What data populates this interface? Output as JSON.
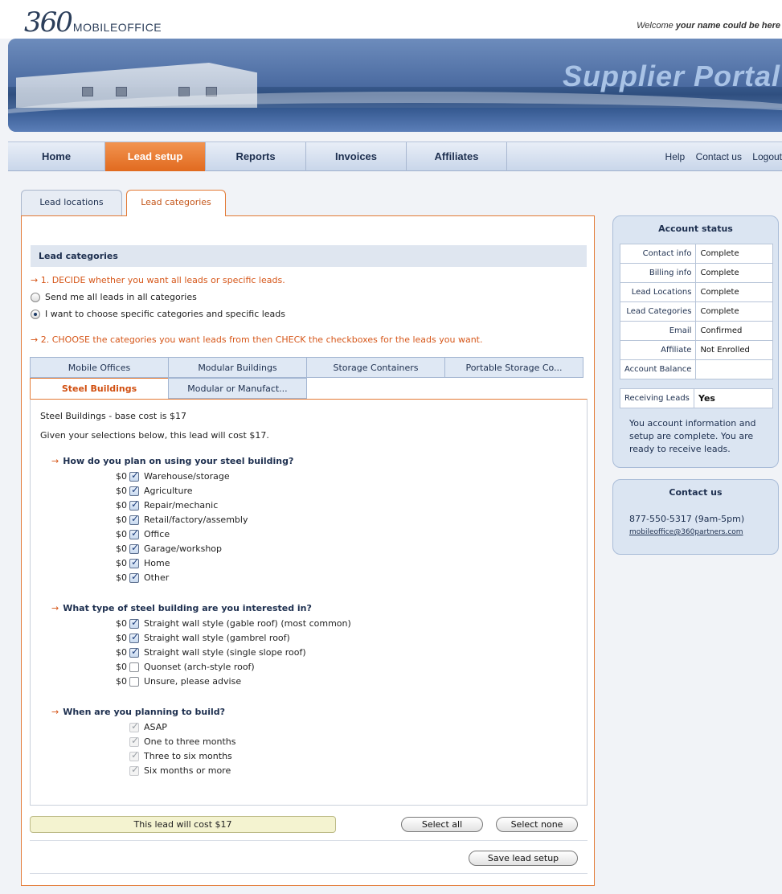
{
  "header": {
    "logo_number": "360",
    "logo_text": "MOBILEOFFICE",
    "welcome_prefix": "Welcome ",
    "welcome_name": "your name could be here",
    "banner_title": "Supplier Portal"
  },
  "nav": {
    "items": [
      {
        "label": "Home"
      },
      {
        "label": "Lead setup"
      },
      {
        "label": "Reports"
      },
      {
        "label": "Invoices"
      },
      {
        "label": "Affiliates"
      }
    ],
    "active": "Lead setup",
    "right": [
      "Help",
      "Contact us",
      "Logout"
    ]
  },
  "page_tabs": [
    {
      "label": "Lead locations"
    },
    {
      "label": "Lead categories"
    }
  ],
  "lead": {
    "section_title": "Lead categories",
    "step1": "→ 1. DECIDE whether you want all leads or specific leads.",
    "radio_all": "Send me all leads in all categories",
    "radio_specific": "I want to choose specific categories and specific leads",
    "step2": "→ 2. CHOOSE the categories you want leads from then CHECK the checkboxes for the leads you want.",
    "categories": [
      "Mobile Offices",
      "Modular Buildings",
      "Storage Containers",
      "Portable Storage Co...",
      "Steel Buildings",
      "Modular or Manufact..."
    ],
    "active_category": "Steel Buildings",
    "base_cost": "Steel Buildings - base cost is $17",
    "given": "Given your selections below, this lead will cost $17.",
    "questions": [
      {
        "title": "How do you plan on using your steel building?",
        "options": [
          {
            "price": "$0",
            "label": "Warehouse/storage",
            "checked": true
          },
          {
            "price": "$0",
            "label": "Agriculture",
            "checked": true
          },
          {
            "price": "$0",
            "label": "Repair/mechanic",
            "checked": true
          },
          {
            "price": "$0",
            "label": "Retail/factory/assembly",
            "checked": true
          },
          {
            "price": "$0",
            "label": "Office",
            "checked": true
          },
          {
            "price": "$0",
            "label": "Garage/workshop",
            "checked": true
          },
          {
            "price": "$0",
            "label": "Home",
            "checked": true
          },
          {
            "price": "$0",
            "label": "Other",
            "checked": true
          }
        ]
      },
      {
        "title": "What type of steel building are you interested in?",
        "options": [
          {
            "price": "$0",
            "label": "Straight wall style (gable roof) (most common)",
            "checked": true
          },
          {
            "price": "$0",
            "label": "Straight wall style (gambrel roof)",
            "checked": true
          },
          {
            "price": "$0",
            "label": "Straight wall style (single slope roof)",
            "checked": true
          },
          {
            "price": "$0",
            "label": "Quonset (arch-style roof)",
            "checked": false
          },
          {
            "price": "$0",
            "label": "Unsure, please advise",
            "checked": false
          }
        ]
      },
      {
        "title": "When are you planning to build?",
        "options": [
          {
            "label": "ASAP",
            "checked": true
          },
          {
            "label": "One to three months",
            "checked": true
          },
          {
            "label": "Three to six months",
            "checked": true
          },
          {
            "label": "Six months or more",
            "checked": true
          }
        ]
      }
    ],
    "cost_bar": "This lead will cost $17",
    "select_all": "Select all",
    "select_none": "Select none",
    "save": "Save lead setup"
  },
  "account": {
    "title": "Account status",
    "rows": [
      {
        "k": "Contact info",
        "v": "Complete"
      },
      {
        "k": "Billing info",
        "v": "Complete"
      },
      {
        "k": "Lead Locations",
        "v": "Complete"
      },
      {
        "k": "Lead Categories",
        "v": "Complete"
      },
      {
        "k": "Email",
        "v": "Confirmed"
      },
      {
        "k": "Affiliate",
        "v": "Not Enrolled"
      },
      {
        "k": "Account Balance",
        "v": ""
      }
    ],
    "receiving_label": "Receiving Leads",
    "receiving_value": "Yes",
    "note": "You account information and setup are complete. You are ready to receive leads."
  },
  "contact": {
    "title": "Contact us",
    "phone": "877-550-5317 (9am-5pm)",
    "email": "mobileoffice@360partners.com"
  },
  "colors": {
    "accent": "#e16a1f",
    "nav_bg": "#c9d6ea",
    "side_bg": "#dbe5f2"
  }
}
